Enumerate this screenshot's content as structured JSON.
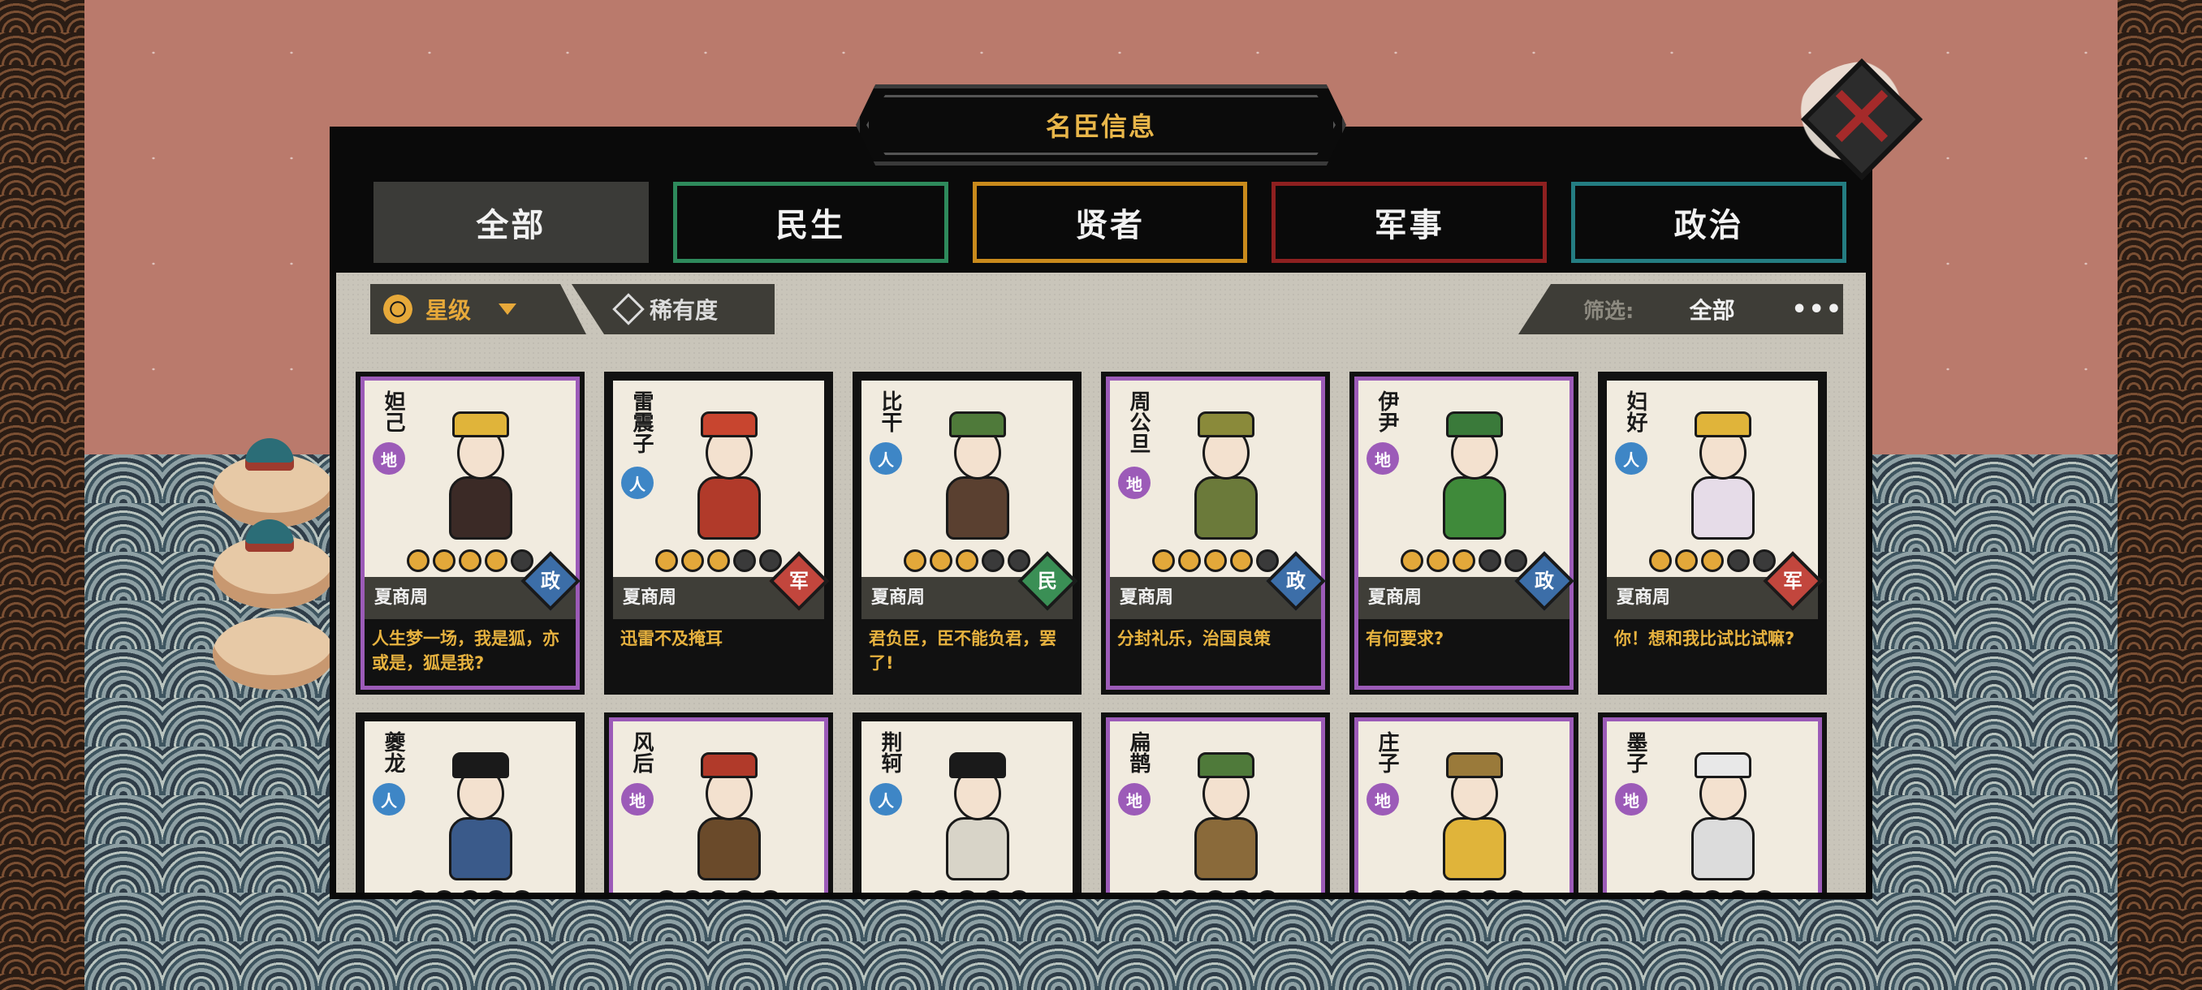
{
  "title": "名臣信息",
  "close_label": "✕",
  "colors": {
    "earth": "#9c5bb8",
    "human": "#3e86c6",
    "politics": "#3c6ea8",
    "military": "#c2463d",
    "people": "#3a8f55",
    "accent": "#e7a93a"
  },
  "tabs": [
    {
      "label": "全部",
      "color": "#3b3b38",
      "active": true
    },
    {
      "label": "民生",
      "color": "#2e8a5c",
      "active": false
    },
    {
      "label": "贤者",
      "color": "#c98a1c",
      "active": false
    },
    {
      "label": "军事",
      "color": "#8e2020",
      "active": false
    },
    {
      "label": "政治",
      "color": "#247d82",
      "active": false
    }
  ],
  "sort": {
    "star_label": "星级",
    "rarity_label": "稀有度"
  },
  "filter": {
    "label": "筛选:",
    "value": "全部",
    "more": "•••"
  },
  "cards": [
    {
      "name": "妲己",
      "tier": "地",
      "tier_kind": "earth",
      "stars": 4,
      "era": "夏商周",
      "type": "政",
      "type_kind": "politics",
      "quote": "人生梦一场，我是狐，亦或是，狐是我?",
      "hat": "#e0b43a",
      "body": "#3b2a26"
    },
    {
      "name": "雷震子",
      "tier": "人",
      "tier_kind": "human",
      "stars": 3,
      "era": "夏商周",
      "type": "军",
      "type_kind": "military",
      "quote": "迅雷不及掩耳",
      "hat": "#c8452f",
      "body": "#b13a2a"
    },
    {
      "name": "比干",
      "tier": "人",
      "tier_kind": "human",
      "stars": 3,
      "era": "夏商周",
      "type": "民",
      "type_kind": "people",
      "quote": "君负臣，臣不能负君，罢了!",
      "hat": "#4f7a3a",
      "body": "#5a4030"
    },
    {
      "name": "周公旦",
      "tier": "地",
      "tier_kind": "earth",
      "stars": 4,
      "era": "夏商周",
      "type": "政",
      "type_kind": "politics",
      "quote": "分封礼乐，治国良策",
      "hat": "#8a8a3a",
      "body": "#6b7a3a"
    },
    {
      "name": "伊尹",
      "tier": "地",
      "tier_kind": "earth",
      "stars": 3,
      "era": "夏商周",
      "type": "政",
      "type_kind": "politics",
      "quote": "有何要求?",
      "hat": "#3a7a3a",
      "body": "#3f8a3a"
    },
    {
      "name": "妇好",
      "tier": "人",
      "tier_kind": "human",
      "stars": 3,
      "era": "夏商周",
      "type": "军",
      "type_kind": "military",
      "quote": "你！想和我比试比试嘛?",
      "hat": "#e0b43a",
      "body": "#e6dce8"
    },
    {
      "name": "夔龙",
      "tier": "人",
      "tier_kind": "human",
      "stars": 5,
      "era": "",
      "type": "",
      "type_kind": "",
      "quote": "",
      "hat": "#1a1a1a",
      "body": "#3a5a8a"
    },
    {
      "name": "风后",
      "tier": "地",
      "tier_kind": "earth",
      "stars": 5,
      "era": "",
      "type": "",
      "type_kind": "",
      "quote": "",
      "hat": "#b13a2a",
      "body": "#6a4a2a"
    },
    {
      "name": "荆轲",
      "tier": "人",
      "tier_kind": "human",
      "stars": 5,
      "era": "",
      "type": "",
      "type_kind": "",
      "quote": "",
      "hat": "#1a1a1a",
      "body": "#d8d4c8"
    },
    {
      "name": "扁鹊",
      "tier": "地",
      "tier_kind": "earth",
      "stars": 5,
      "era": "",
      "type": "",
      "type_kind": "",
      "quote": "",
      "hat": "#4f7a3a",
      "body": "#8a6a3a"
    },
    {
      "name": "庄子",
      "tier": "地",
      "tier_kind": "earth",
      "stars": 5,
      "era": "",
      "type": "",
      "type_kind": "",
      "quote": "",
      "hat": "#9a7a3a",
      "body": "#e0b43a"
    },
    {
      "name": "墨子",
      "tier": "地",
      "tier_kind": "earth",
      "stars": 5,
      "era": "",
      "type": "",
      "type_kind": "",
      "quote": "",
      "hat": "#e8e8e8",
      "body": "#dcdcdc"
    }
  ]
}
